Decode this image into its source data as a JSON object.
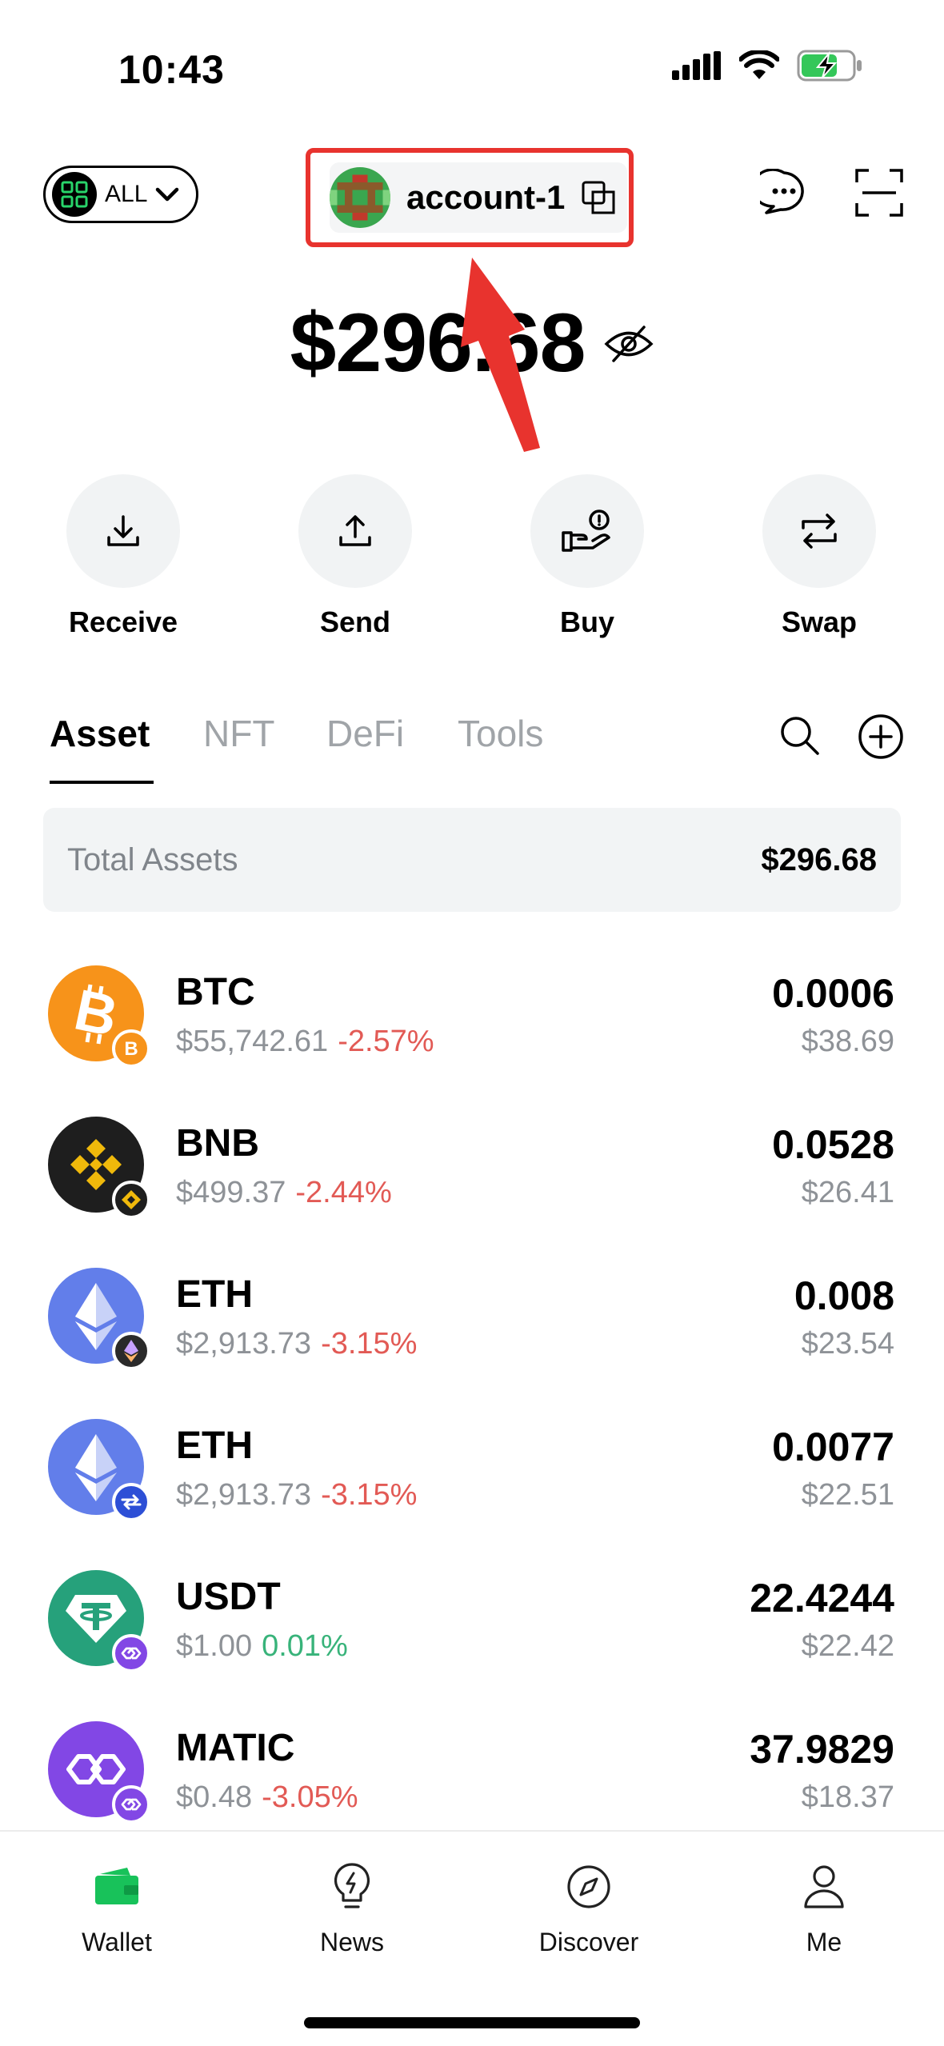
{
  "status_bar": {
    "time": "10:43"
  },
  "header": {
    "filter_label": "ALL",
    "account_name": "account-1",
    "highlight_color": "#e8332e"
  },
  "balance": {
    "value": "$296.68"
  },
  "actions": [
    {
      "label": "Receive",
      "icon": "download-icon"
    },
    {
      "label": "Send",
      "icon": "upload-icon"
    },
    {
      "label": "Buy",
      "icon": "buy-hand-coin-icon"
    },
    {
      "label": "Swap",
      "icon": "swap-arrows-icon"
    }
  ],
  "tabs": [
    {
      "label": "Asset",
      "active": true
    },
    {
      "label": "NFT",
      "active": false
    },
    {
      "label": "DeFi",
      "active": false
    },
    {
      "label": "Tools",
      "active": false
    }
  ],
  "total_assets": {
    "label": "Total Assets",
    "value": "$296.68"
  },
  "assets": [
    {
      "symbol": "BTC",
      "price": "$55,742.61",
      "change": "-2.57%",
      "direction": "down",
      "amount": "0.0006",
      "value": "$38.69",
      "icon_color": "#f7931a",
      "chain_badge": "bitcoin-badge-icon"
    },
    {
      "symbol": "BNB",
      "price": "$499.37",
      "change": "-2.44%",
      "direction": "down",
      "amount": "0.0528",
      "value": "$26.41",
      "icon_color": "#1e1e1e",
      "chain_badge": "bnb-chain-badge-icon"
    },
    {
      "symbol": "ETH",
      "price": "$2,913.73",
      "change": "-3.15%",
      "direction": "down",
      "amount": "0.008",
      "value": "$23.54",
      "icon_color": "#627eea",
      "chain_badge": "ethereum-badge-icon"
    },
    {
      "symbol": "ETH",
      "price": "$2,913.73",
      "change": "-3.15%",
      "direction": "down",
      "amount": "0.0077",
      "value": "$22.51",
      "icon_color": "#627eea",
      "chain_badge": "arbitrum-badge-icon"
    },
    {
      "symbol": "USDT",
      "price": "$1.00",
      "change": "0.01%",
      "direction": "up",
      "amount": "22.4244",
      "value": "$22.42",
      "icon_color": "#26a17b",
      "chain_badge": "polygon-badge-icon"
    },
    {
      "symbol": "MATIC",
      "price": "$0.48",
      "change": "-3.05%",
      "direction": "down",
      "amount": "37.9829",
      "value": "$18.37",
      "icon_color": "#8247e5",
      "chain_badge": "polygon-badge-icon"
    }
  ],
  "bottom_nav": [
    {
      "label": "Wallet",
      "icon": "wallet-icon",
      "active": true
    },
    {
      "label": "News",
      "icon": "lightbulb-icon",
      "active": false
    },
    {
      "label": "Discover",
      "icon": "compass-icon",
      "active": false
    },
    {
      "label": "Me",
      "icon": "person-icon",
      "active": false
    }
  ]
}
